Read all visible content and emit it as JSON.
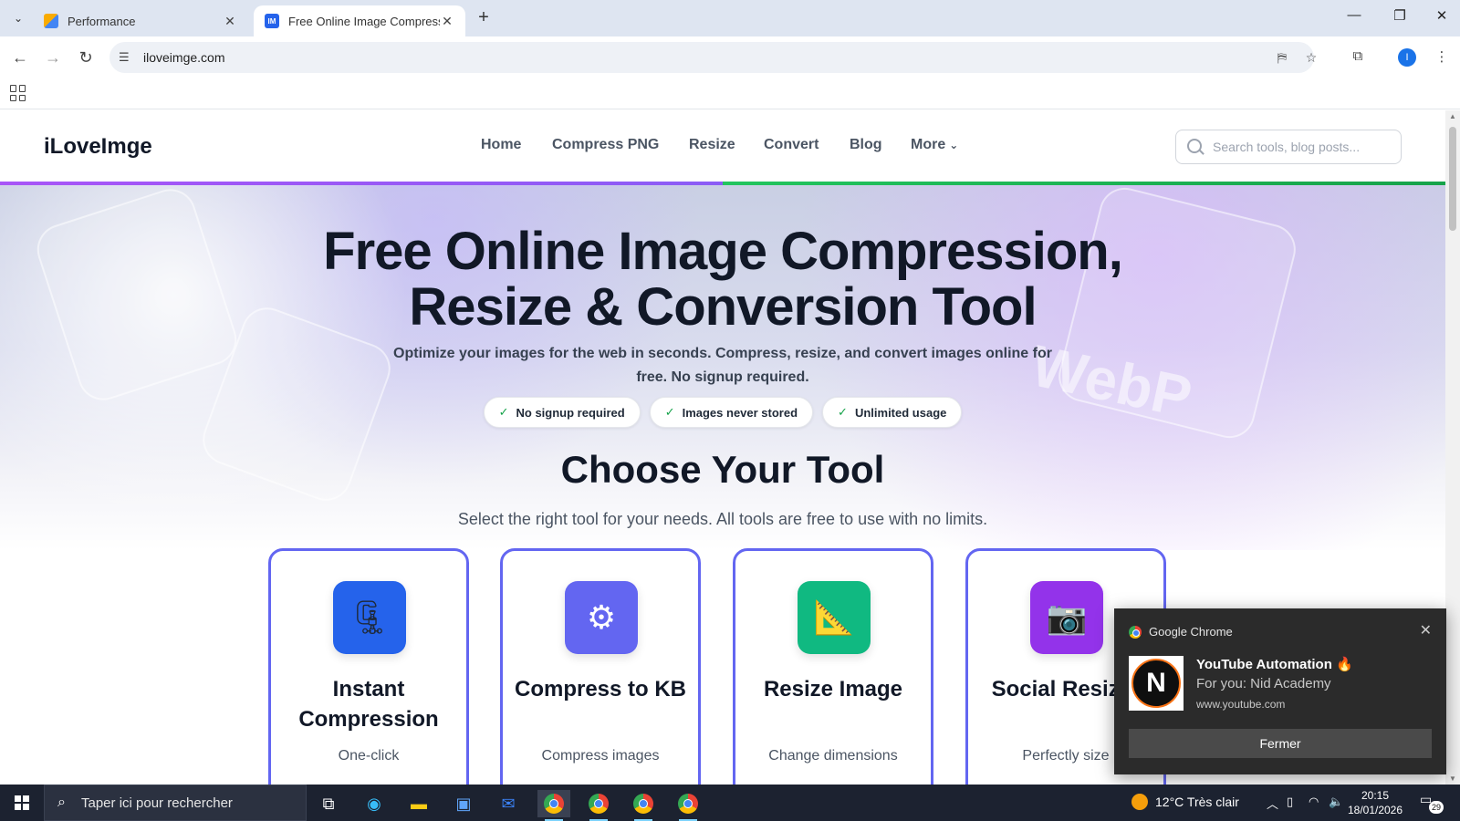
{
  "browser": {
    "tabs": [
      {
        "title": "Performance",
        "active": false
      },
      {
        "title": "Free Online Image Compression",
        "active": true
      }
    ],
    "active_tab_favicon": "IM",
    "new_tab_label": "+",
    "url": "iloveimge.com",
    "profile_initial": "I",
    "icons": [
      "tab-search-icon",
      "back-icon",
      "forward-icon",
      "reload-icon",
      "site-settings-icon",
      "translate-icon",
      "star-icon",
      "extensions-icon",
      "menu-dots-icon",
      "apps-grid-icon"
    ]
  },
  "site": {
    "logo": "iLoveImge",
    "nav": [
      "Home",
      "Compress PNG",
      "Resize",
      "Convert",
      "Blog",
      "More"
    ],
    "search_placeholder": "Search tools, blog posts...",
    "accent_colors": {
      "purple": "#a855f7",
      "green": "#22c55e",
      "card_border": "#6366f1"
    }
  },
  "hero": {
    "title_line1": "Free Online Image Compression,",
    "title_line2": "Resize & Conversion Tool",
    "subtitle": "Optimize your images for the web in seconds. Compress, resize, and convert images online for free. No signup required.",
    "badges": [
      "No signup required",
      "Images never stored",
      "Unlimited usage"
    ],
    "bg_text": "WebP"
  },
  "tools_section": {
    "title": "Choose Your Tool",
    "subtitle": "Select the right tool for your needs. All tools are free to use with no limits.",
    "cards": [
      {
        "name": "Instant Compression",
        "desc": "One-click",
        "icon": "clamp-icon",
        "glyph": "🗜",
        "color": "#2563eb"
      },
      {
        "name": "Compress to KB",
        "desc": "Compress images",
        "icon": "gear-icon",
        "glyph": "⚙",
        "color": "#6366f1"
      },
      {
        "name": "Resize Image",
        "desc": "Change dimensions",
        "icon": "triangle-ruler-icon",
        "glyph": "📐",
        "color": "#10b981"
      },
      {
        "name": "Social Resizer",
        "desc": "Perfectly size",
        "icon": "camera-icon",
        "glyph": "📷",
        "color": "#9333ea"
      }
    ]
  },
  "notification": {
    "app": "Google Chrome",
    "title": "YouTube Automation 🔥",
    "body": "For you: Nid Academy",
    "source": "www.youtube.com",
    "button": "Fermer",
    "avatar_letter": "N"
  },
  "taskbar": {
    "search_placeholder": "Taper ici pour rechercher",
    "weather": "12°C  Très clair",
    "time": "20:15",
    "date": "18/01/2026",
    "notification_count": "29"
  }
}
